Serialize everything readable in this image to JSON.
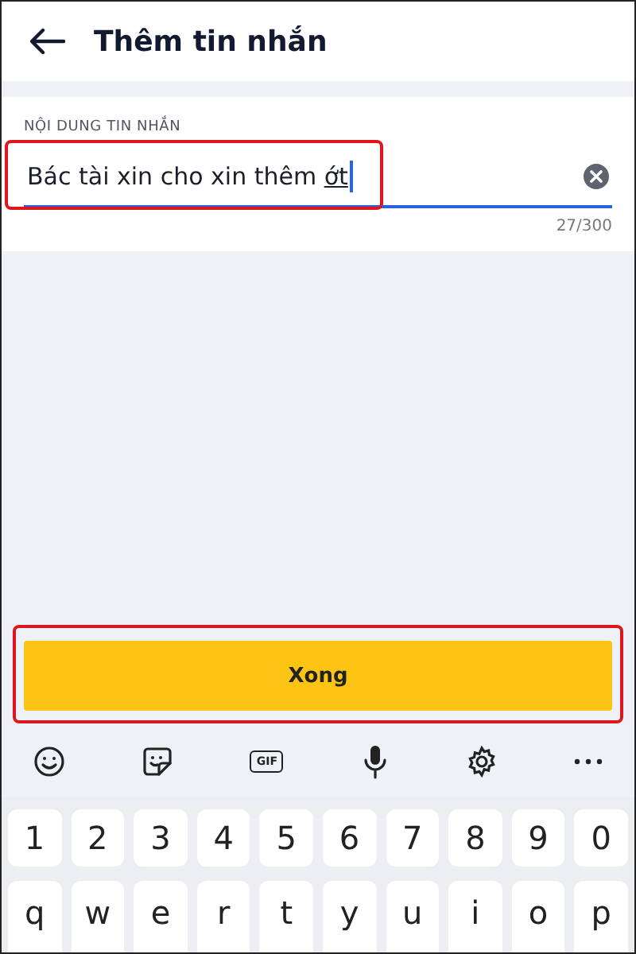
{
  "header": {
    "title": "Thêm tin nhắn"
  },
  "message_field": {
    "label": "NỘI DUNG TIN NHẮN",
    "value": "Bác tài xin cho xin thêm ",
    "composing": "ớt",
    "counter": "27/300",
    "highlighted": true
  },
  "done_button": {
    "label": "Xong",
    "highlighted": true
  },
  "keyboard_toolbar": [
    {
      "kind": "emoji"
    },
    {
      "kind": "sticker"
    },
    {
      "kind": "gif",
      "label": "GIF"
    },
    {
      "kind": "mic"
    },
    {
      "kind": "settings"
    },
    {
      "kind": "more"
    }
  ],
  "keyboard_rows": [
    [
      "1",
      "2",
      "3",
      "4",
      "5",
      "6",
      "7",
      "8",
      "9",
      "0"
    ],
    [
      "q",
      "w",
      "e",
      "r",
      "t",
      "y",
      "u",
      "i",
      "o",
      "p"
    ]
  ]
}
